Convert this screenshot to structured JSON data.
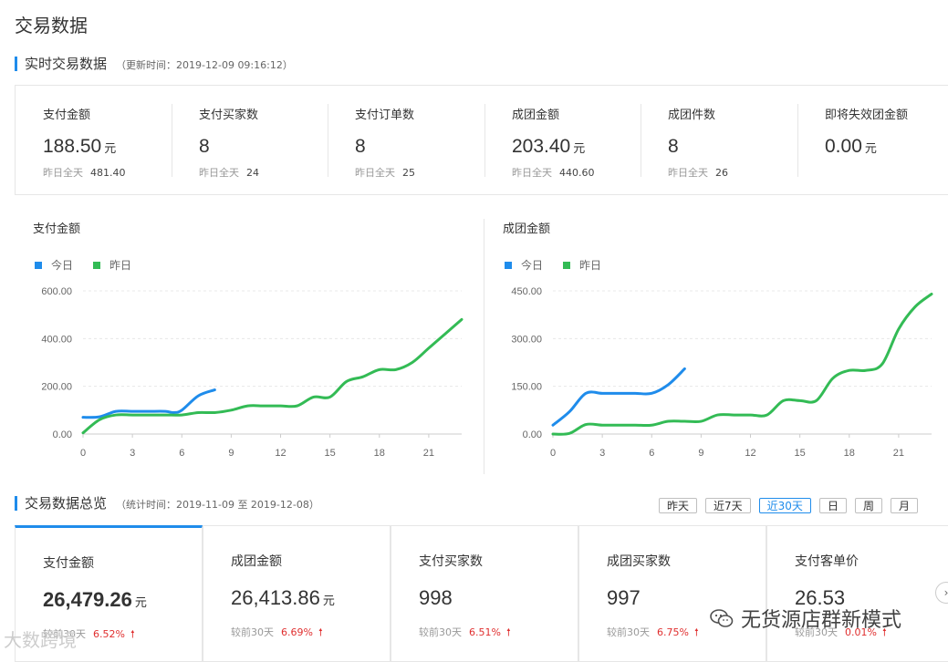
{
  "page": {
    "title": "交易数据"
  },
  "realtime": {
    "title": "实时交易数据",
    "update_note": "（更新时间：2019-12-09 09:16:12）",
    "metrics": [
      {
        "label": "支付金额",
        "value": "188.50",
        "unit": "元",
        "sub_label": "昨日全天",
        "sub_value": "481.40"
      },
      {
        "label": "支付买家数",
        "value": "8",
        "unit": "",
        "sub_label": "昨日全天",
        "sub_value": "24"
      },
      {
        "label": "支付订单数",
        "value": "8",
        "unit": "",
        "sub_label": "昨日全天",
        "sub_value": "25"
      },
      {
        "label": "成团金额",
        "value": "203.40",
        "unit": "元",
        "sub_label": "昨日全天",
        "sub_value": "440.60"
      },
      {
        "label": "成团件数",
        "value": "8",
        "unit": "",
        "sub_label": "昨日全天",
        "sub_value": "26"
      },
      {
        "label": "即将失效团金额",
        "value": "0.00",
        "unit": "元",
        "sub_label": "",
        "sub_value": ""
      }
    ]
  },
  "chart_data": [
    {
      "type": "line",
      "title": "支付金额",
      "xlabel": "",
      "ylabel": "",
      "x_ticks": [
        "0",
        "3",
        "6",
        "9",
        "12",
        "15",
        "18",
        "21"
      ],
      "y_ticks": [
        "0.00",
        "200.00",
        "400.00",
        "600.00"
      ],
      "xlim": [
        0,
        23
      ],
      "ylim": [
        0,
        600
      ],
      "legend_position": "top-left",
      "series": [
        {
          "name": "今日",
          "color": "#1f8ceb",
          "x": [
            0,
            1,
            2,
            3,
            4,
            5,
            5.5,
            6,
            7,
            8
          ],
          "y": [
            70,
            72,
            95,
            95,
            95,
            95,
            90,
            100,
            160,
            185
          ]
        },
        {
          "name": "昨日",
          "color": "#33bb55",
          "x": [
            0,
            1,
            2,
            3,
            4,
            5,
            6,
            7,
            8,
            9,
            10,
            11,
            12,
            13,
            14,
            15,
            16,
            17,
            18,
            19,
            20,
            21,
            22,
            23
          ],
          "y": [
            5,
            60,
            80,
            80,
            80,
            80,
            80,
            90,
            90,
            100,
            118,
            118,
            118,
            118,
            155,
            155,
            220,
            240,
            270,
            270,
            300,
            360,
            420,
            480
          ]
        }
      ]
    },
    {
      "type": "line",
      "title": "成团金额",
      "xlabel": "",
      "ylabel": "",
      "x_ticks": [
        "0",
        "3",
        "6",
        "9",
        "12",
        "15",
        "18",
        "21"
      ],
      "y_ticks": [
        "0.00",
        "150.00",
        "300.00",
        "450.00"
      ],
      "xlim": [
        0,
        23
      ],
      "ylim": [
        0,
        450
      ],
      "legend_position": "top-left",
      "series": [
        {
          "name": "今日",
          "color": "#1f8ceb",
          "x": [
            0,
            1,
            2,
            3,
            4,
            5,
            6,
            7,
            8
          ],
          "y": [
            28,
            70,
            128,
            128,
            128,
            128,
            128,
            155,
            205
          ]
        },
        {
          "name": "昨日",
          "color": "#33bb55",
          "x": [
            0,
            1,
            2,
            3,
            4,
            5,
            6,
            7,
            8,
            9,
            10,
            11,
            12,
            13,
            14,
            15,
            16,
            17,
            18,
            19,
            20,
            21,
            22,
            23
          ],
          "y": [
            0,
            2,
            30,
            28,
            28,
            28,
            28,
            40,
            40,
            40,
            60,
            60,
            60,
            60,
            105,
            105,
            105,
            175,
            200,
            200,
            220,
            330,
            400,
            440
          ]
        }
      ]
    }
  ],
  "overview": {
    "title": "交易数据总览",
    "stat_note": "（统计时间：2019-11-09 至 2019-12-08）",
    "ranges": [
      "昨天",
      "近7天",
      "近30天",
      "日",
      "周",
      "月"
    ],
    "active_range_index": 2,
    "cards": [
      {
        "label": "支付金额",
        "value": "26,479.26",
        "unit": "元",
        "cmp_label": "较前30天",
        "pct": "6.52%"
      },
      {
        "label": "成团金额",
        "value": "26,413.86",
        "unit": "元",
        "cmp_label": "较前30天",
        "pct": "6.69%"
      },
      {
        "label": "支付买家数",
        "value": "998",
        "unit": "",
        "cmp_label": "较前30天",
        "pct": "6.51%"
      },
      {
        "label": "成团买家数",
        "value": "997",
        "unit": "",
        "cmp_label": "较前30天",
        "pct": "6.75%"
      },
      {
        "label": "支付客单价",
        "value": "26.53",
        "unit": "",
        "cmp_label": "较前30天",
        "pct": "0.01%"
      }
    ],
    "up_arrow": "🠕"
  },
  "watermarks": {
    "right": "无货源店群新模式",
    "left": "大数跨境"
  },
  "colors": {
    "accent": "#1f8ceb",
    "today": "#1f8ceb",
    "yesterday": "#33bb55",
    "up": "#e02f2f"
  }
}
